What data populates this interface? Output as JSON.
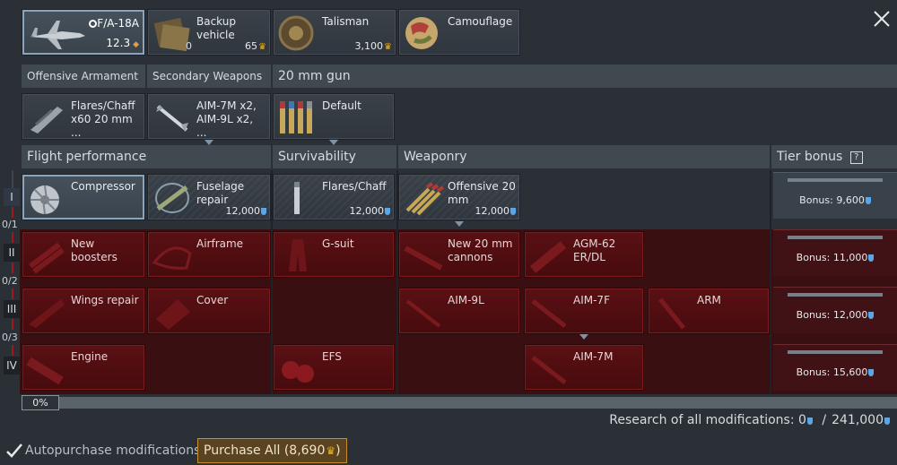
{
  "top_slots": {
    "vehicle": {
      "name": "F/A-18A",
      "rank": "12.3"
    },
    "backup": {
      "label": "Backup vehicle",
      "count": "0",
      "cost": "65"
    },
    "talisman": {
      "label": "Talisman",
      "cost": "3,100"
    },
    "camouflage": {
      "label": "Camouflage"
    }
  },
  "weapon_headers": {
    "offensive": "Offensive Armament",
    "secondary": "Secondary Weapons",
    "gun": "20 mm gun"
  },
  "weapons": {
    "offensive": "Flares/Chaff x60 20 mm ...",
    "secondary": "AIM-7M x2, AIM-9L x2, ...",
    "gun": "Default"
  },
  "columns": {
    "flight": "Flight performance",
    "survivability": "Survivability",
    "weaponry": "Weaponry",
    "tier_bonus": "Tier bonus",
    "help": "?"
  },
  "tiers": [
    "I",
    "II",
    "III",
    "IV"
  ],
  "fractions": [
    "0/1",
    "0/2",
    "0/3"
  ],
  "mods": {
    "compressor": "Compressor",
    "fuselage": {
      "label": "Fuselage repair",
      "cost": "12,000"
    },
    "flares": {
      "label": "Flares/Chaff",
      "cost": "12,000"
    },
    "offensive20": {
      "label": "Offensive 20 mm",
      "cost": "12,000"
    },
    "new_boosters": "New boosters",
    "airframe": "Airframe",
    "gsuit": "G-suit",
    "new20": "New 20 mm cannons",
    "agm62": "AGM-62 ER/DL",
    "wings": "Wings repair",
    "cover": "Cover",
    "aim9l": "AIM-9L",
    "aim7f": "AIM-7F",
    "arm": "ARM",
    "engine": "Engine",
    "efs": "EFS",
    "aim7m": "AIM-7M"
  },
  "bonuses": [
    "Bonus: 9,600",
    "Bonus: 11,000",
    "Bonus: 12,000",
    "Bonus: 15,600"
  ],
  "progress": {
    "label": "0%",
    "value": 0
  },
  "research": {
    "text": "Research of all modifications: 0",
    "sep": "/",
    "total": "241,000"
  },
  "footer": {
    "autopurchase": "Autopurchase modifications",
    "purchase_all": "Purchase All (8,690"
  },
  "colors": {
    "locked_red": "#5a1013",
    "accent_gold": "#e9b21f",
    "gem_blue": "#5aa6e8"
  }
}
